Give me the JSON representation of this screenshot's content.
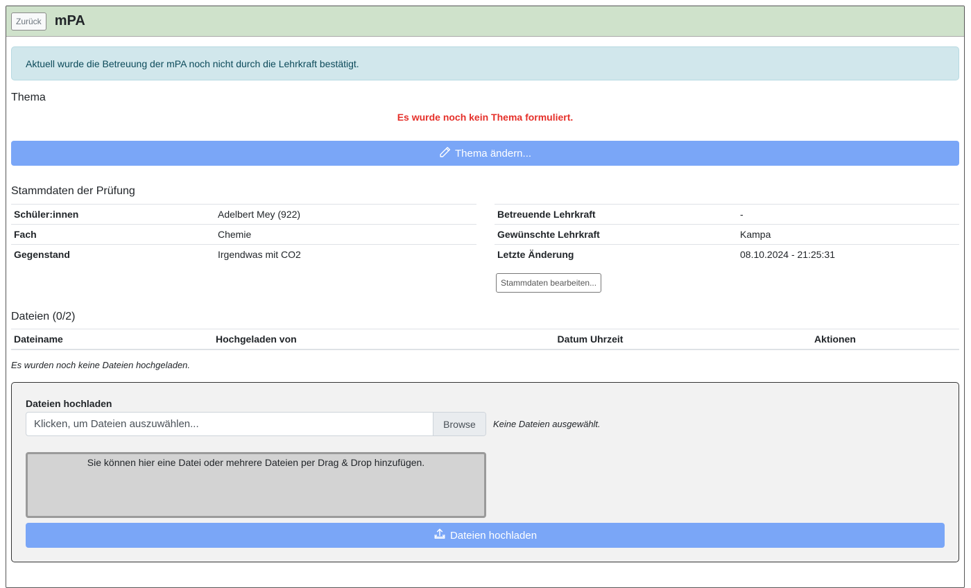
{
  "header": {
    "back_label": "Zurück",
    "title": "mPA"
  },
  "alert": {
    "text": "Aktuell wurde die Betreuung der mPA noch nicht durch die Lehrkraft bestätigt."
  },
  "thema": {
    "heading": "Thema",
    "warning": "Es wurde noch kein Thema formuliert.",
    "button_label": "Thema ändern...",
    "button_icon": "pencil-icon"
  },
  "stammdaten": {
    "heading": "Stammdaten der Prüfung",
    "left": [
      {
        "key": "Schüler:innen",
        "value": "Adelbert Mey (922)"
      },
      {
        "key": "Fach",
        "value": "Chemie"
      },
      {
        "key": "Gegenstand",
        "value": "Irgendwas mit CO2"
      }
    ],
    "right": [
      {
        "key": "Betreuende Lehrkraft",
        "value": "-"
      },
      {
        "key": "Gewünschte Lehrkraft",
        "value": "Kampa"
      },
      {
        "key": "Letzte Änderung",
        "value": "08.10.2024 - 21:25:31"
      }
    ],
    "edit_button_label": "Stammdaten bearbeiten..."
  },
  "dateien": {
    "heading": "Dateien (0/2)",
    "columns": [
      "Dateiname",
      "Hochgeladen von",
      "Datum Uhrzeit",
      "Aktionen"
    ],
    "empty_text": "Es wurden noch keine Dateien hochgeladen."
  },
  "upload": {
    "label": "Dateien hochladen",
    "input_placeholder": "Klicken, um Dateien auszuwählen...",
    "browse_label": "Browse",
    "no_files_text": "Keine Dateien ausgewählt.",
    "drop_zone_text": "Sie können hier eine Datei oder mehrere Dateien per Drag & Drop hinzufügen.",
    "button_label": "Dateien hochladen",
    "button_icon": "upload-icon"
  },
  "colors": {
    "header_bg": "#cfe2cb",
    "alert_bg": "#d1e7ec",
    "warning_text": "#e5302a",
    "primary_button": "#7aa6f7",
    "drop_zone_bg": "#d3d3d3"
  }
}
